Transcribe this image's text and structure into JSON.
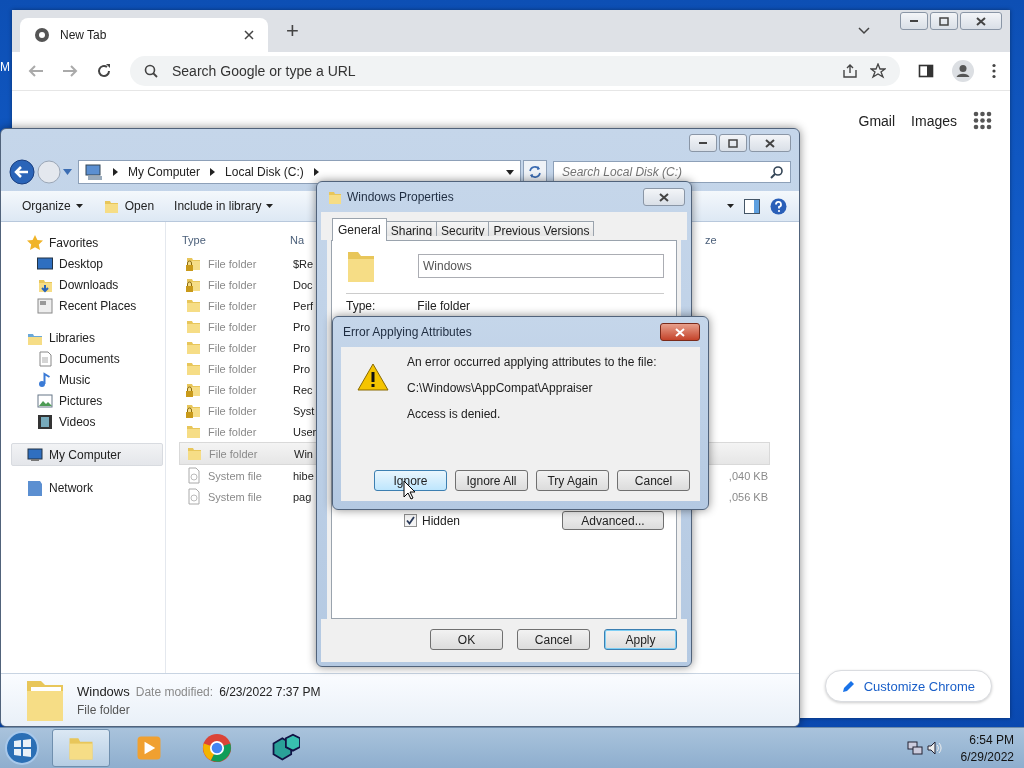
{
  "desktop": {
    "icon_label": "M"
  },
  "chrome": {
    "tab": {
      "title": "New Tab",
      "selected": true
    },
    "new_tab_button": "+",
    "omnibox": {
      "placeholder": "Search Google or type a URL"
    },
    "links": [
      "Gmail",
      "Images"
    ],
    "customize_button": "Customize Chrome"
  },
  "explorer": {
    "breadcrumb": [
      "My Computer",
      "Local Disk (C:)"
    ],
    "search": {
      "placeholder": "Search Local Disk (C:)"
    },
    "toolbar": [
      {
        "label": "Organize",
        "dropdown": true
      },
      {
        "label": "Open",
        "dropdown": false
      },
      {
        "label": "Include in library",
        "dropdown": true
      }
    ],
    "sidebar": [
      {
        "label": "Favorites",
        "selected": false,
        "children": [
          {
            "label": "Desktop",
            "selected": false
          },
          {
            "label": "Downloads",
            "selected": false
          },
          {
            "label": "Recent Places",
            "selected": false
          }
        ]
      },
      {
        "label": "Libraries",
        "selected": false,
        "children": [
          {
            "label": "Documents",
            "selected": false
          },
          {
            "label": "Music",
            "selected": false
          },
          {
            "label": "Pictures",
            "selected": false
          },
          {
            "label": "Videos",
            "selected": false
          }
        ]
      },
      {
        "label": "My Computer",
        "selected": true
      },
      {
        "label": "Network",
        "selected": false
      }
    ],
    "columns": [
      "Type",
      "Na",
      "ze"
    ],
    "rows": [
      {
        "kind": "folder",
        "type": "File folder",
        "name": "$Re",
        "locked": true,
        "selected": false
      },
      {
        "kind": "folder",
        "type": "File folder",
        "name": "Doc",
        "locked": true,
        "selected": false
      },
      {
        "kind": "folder",
        "type": "File folder",
        "name": "Perf",
        "locked": false,
        "selected": false
      },
      {
        "kind": "folder",
        "type": "File folder",
        "name": "Pro",
        "locked": false,
        "selected": false
      },
      {
        "kind": "folder",
        "type": "File folder",
        "name": "Pro",
        "locked": false,
        "selected": false
      },
      {
        "kind": "folder",
        "type": "File folder",
        "name": "Pro",
        "locked": false,
        "selected": false
      },
      {
        "kind": "folder",
        "type": "File folder",
        "name": "Rec",
        "locked": true,
        "selected": false
      },
      {
        "kind": "folder",
        "type": "File folder",
        "name": "Syst",
        "locked": true,
        "selected": false
      },
      {
        "kind": "folder",
        "type": "File folder",
        "name": "User",
        "locked": false,
        "selected": false
      },
      {
        "kind": "folder",
        "type": "File folder",
        "name": "Win",
        "locked": false,
        "selected": true
      },
      {
        "kind": "file",
        "type": "System file",
        "name": "hibe",
        "size": ",040 KB",
        "selected": false
      },
      {
        "kind": "file",
        "type": "System file",
        "name": "pag",
        "size": ",056 KB",
        "selected": false
      }
    ],
    "details": {
      "name": "Windows",
      "date_label": "Date modified:",
      "date": "6/23/2022 7:37 PM",
      "type": "File folder"
    }
  },
  "properties": {
    "title": "Windows Properties",
    "tabs": [
      {
        "label": "General",
        "selected": true
      },
      {
        "label": "Sharing",
        "selected": false
      },
      {
        "label": "Security",
        "selected": false
      },
      {
        "label": "Previous Versions",
        "selected": false
      }
    ],
    "name_value": "Windows",
    "type_label": "Type:",
    "type_value": "File folder",
    "hidden": {
      "label": "Hidden",
      "checked": true
    },
    "advanced_button": "Advanced...",
    "buttons": [
      {
        "label": "OK",
        "default": false
      },
      {
        "label": "Cancel",
        "default": false
      },
      {
        "label": "Apply",
        "default": true
      }
    ]
  },
  "error": {
    "title": "Error Applying Attributes",
    "message": "An error occurred applying attributes to the file:",
    "path": "C:\\Windows\\AppCompat\\Appraiser",
    "detail": "Access is denied.",
    "buttons": [
      {
        "label": "Ignore",
        "focused": true
      },
      {
        "label": "Ignore All",
        "focused": false
      },
      {
        "label": "Try Again",
        "focused": false
      },
      {
        "label": "Cancel",
        "focused": false
      }
    ]
  },
  "taskbar": {
    "apps": [
      {
        "active": true
      },
      {
        "active": false
      },
      {
        "active": false
      },
      {
        "active": false
      }
    ],
    "clock": {
      "time": "6:54 PM",
      "date": "6/29/2022"
    }
  }
}
